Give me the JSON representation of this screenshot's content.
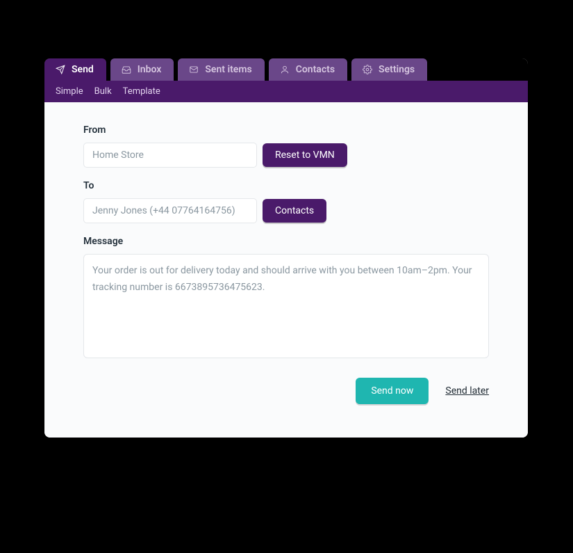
{
  "tabs": [
    {
      "label": "Send",
      "icon": "send-icon"
    },
    {
      "label": "Inbox",
      "icon": "inbox-icon"
    },
    {
      "label": "Sent items",
      "icon": "sent-items-icon"
    },
    {
      "label": "Contacts",
      "icon": "contacts-icon"
    },
    {
      "label": "Settings",
      "icon": "settings-icon"
    }
  ],
  "subnav": [
    {
      "label": "Simple"
    },
    {
      "label": "Bulk"
    },
    {
      "label": "Template"
    }
  ],
  "form": {
    "from_label": "From",
    "from_value": "Home Store",
    "reset_button": "Reset to VMN",
    "to_label": "To",
    "to_value": "Jenny Jones (+44 07764164756)",
    "contacts_button": "Contacts",
    "message_label": "Message",
    "message_value": "Your order is out for delivery today and should arrive with you between 10am–2pm. Your tracking number is 6673895736475623."
  },
  "actions": {
    "send_now": "Send now",
    "send_later": "Send later"
  }
}
